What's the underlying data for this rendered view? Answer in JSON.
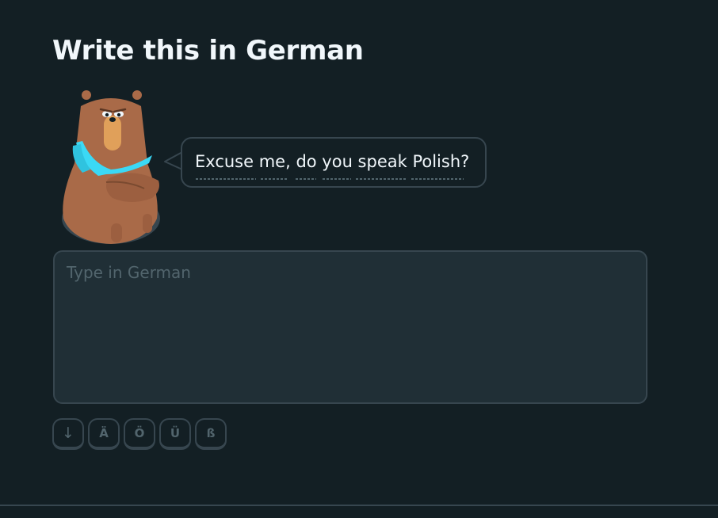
{
  "exercise": {
    "title": "Write this in German",
    "prompt": "Excuse me, do you speak Polish?"
  },
  "answer": {
    "placeholder": "Type in German",
    "value": ""
  },
  "keyboard": {
    "keys": [
      "↓",
      "Ä",
      "Ö",
      "Ü",
      "ß"
    ]
  },
  "character": {
    "icon": "bear-character-icon"
  },
  "colors": {
    "background": "#131f24",
    "text": "#f1f7fb",
    "border": "#37464f",
    "input_background": "#202f36",
    "muted": "#52656d",
    "scarf": "#3bd9f5",
    "bear_fur": "#a96a48"
  }
}
